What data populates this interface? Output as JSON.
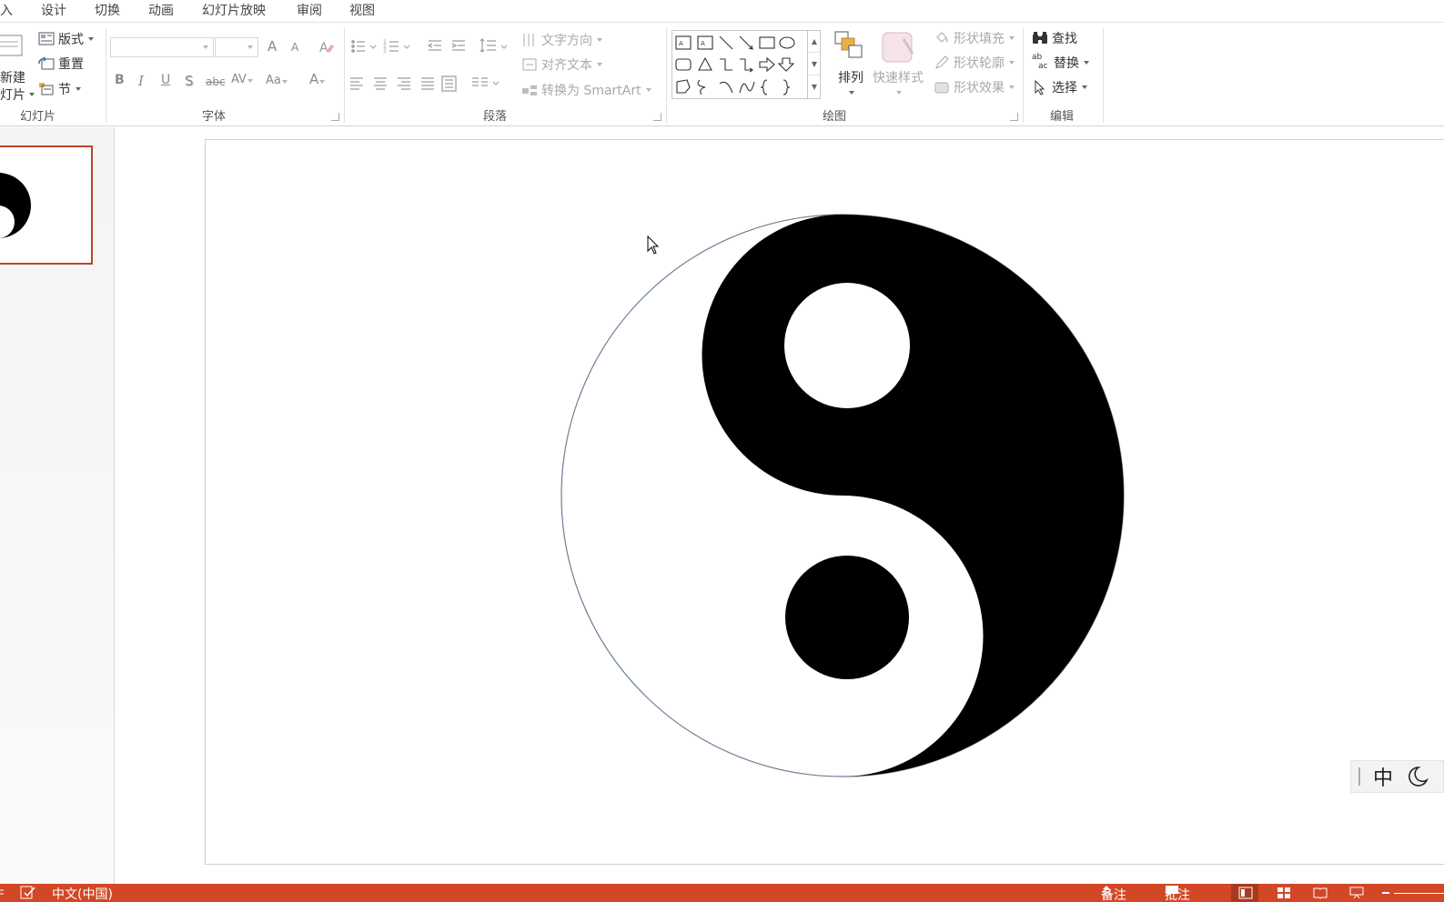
{
  "menu": {
    "insert": "入",
    "design": "设计",
    "transitions": "切换",
    "animations": "动画",
    "slideshow": "幻灯片放映",
    "review": "审阅",
    "view": "视图"
  },
  "ribbon": {
    "slides": {
      "label": "幻灯片",
      "new_slide_line1": "新建",
      "new_slide_line2": "灯片",
      "layout": "版式",
      "reset": "重置",
      "section": "节"
    },
    "font": {
      "label": "字体",
      "bold": "B",
      "italic": "I",
      "underline": "U",
      "shadow": "S",
      "strike": "abc",
      "spacing": "AV",
      "case": "Aa",
      "color": "A",
      "grow": "A",
      "shrink": "A"
    },
    "paragraph": {
      "label": "段落",
      "text_direction": "文字方向",
      "align_text": "对齐文本",
      "convert_smartart": "转换为 SmartArt"
    },
    "drawing": {
      "label": "绘图",
      "arrange": "排列",
      "quick_styles": "快速样式",
      "shape_fill": "形状填充",
      "shape_outline": "形状轮廓",
      "shape_effects": "形状效果"
    },
    "editing": {
      "label": "编辑",
      "find": "查找",
      "replace": "替换",
      "select": "选择",
      "replace_icon_top": "ab",
      "replace_icon_bottom": "ac"
    }
  },
  "ime": {
    "mode": "中"
  },
  "statusbar": {
    "language": "中文(中国)",
    "notes": "备注",
    "comments": "批注"
  },
  "colors": {
    "accent": "#d24726",
    "thumb_border": "#b7472a",
    "status_text": "#ffffff",
    "disabled": "#a8a8a8"
  }
}
